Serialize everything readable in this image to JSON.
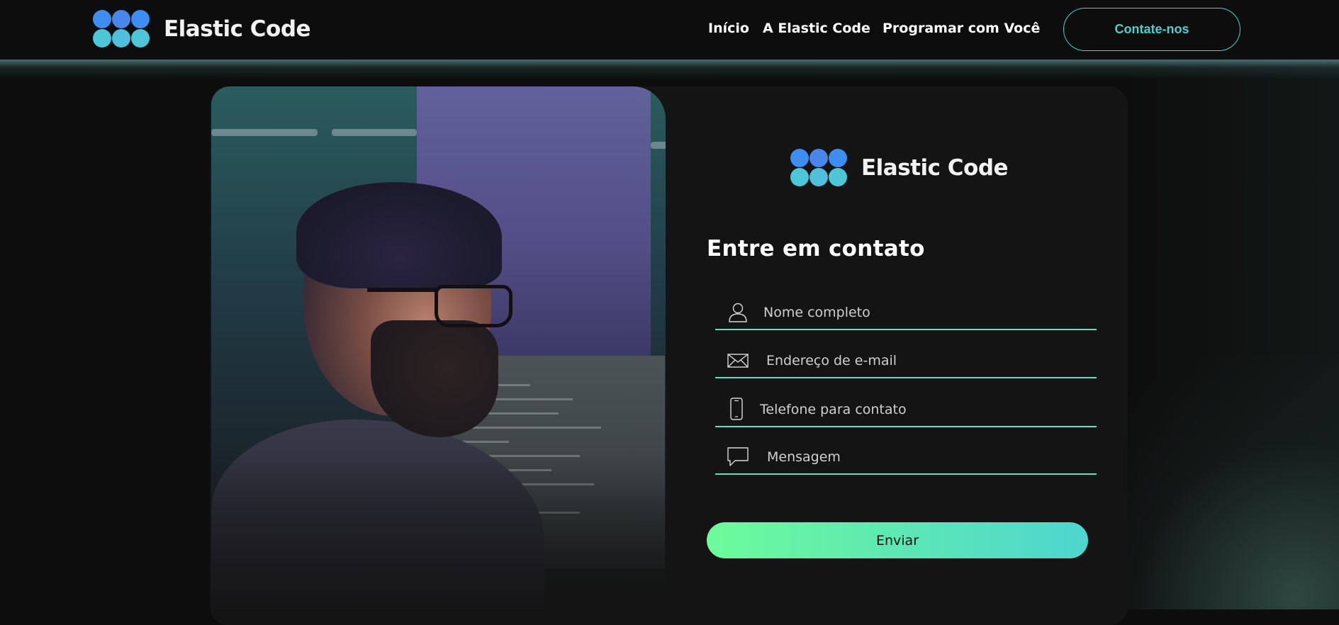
{
  "brand": {
    "name": "Elastic Code",
    "logo_icon": "elastic-code-logo",
    "colors": {
      "blue": "#3f8fe8",
      "teal": "#48d1cc",
      "green": "#6dfb9a"
    }
  },
  "nav": {
    "items": [
      {
        "label": "Início"
      },
      {
        "label": "A Elastic Code"
      },
      {
        "label": "Programar com Você"
      }
    ],
    "cta_label": "Contate-nos"
  },
  "contact": {
    "title": "Entre em contato",
    "fields": [
      {
        "icon": "user-icon",
        "placeholder": "Nome completo"
      },
      {
        "icon": "envelope-icon",
        "placeholder": "Endereço de e-mail"
      },
      {
        "icon": "phone-icon",
        "placeholder": "Telefone para contato"
      },
      {
        "icon": "chat-icon",
        "placeholder": "Mensagem"
      }
    ],
    "submit_label": "Enviar"
  }
}
